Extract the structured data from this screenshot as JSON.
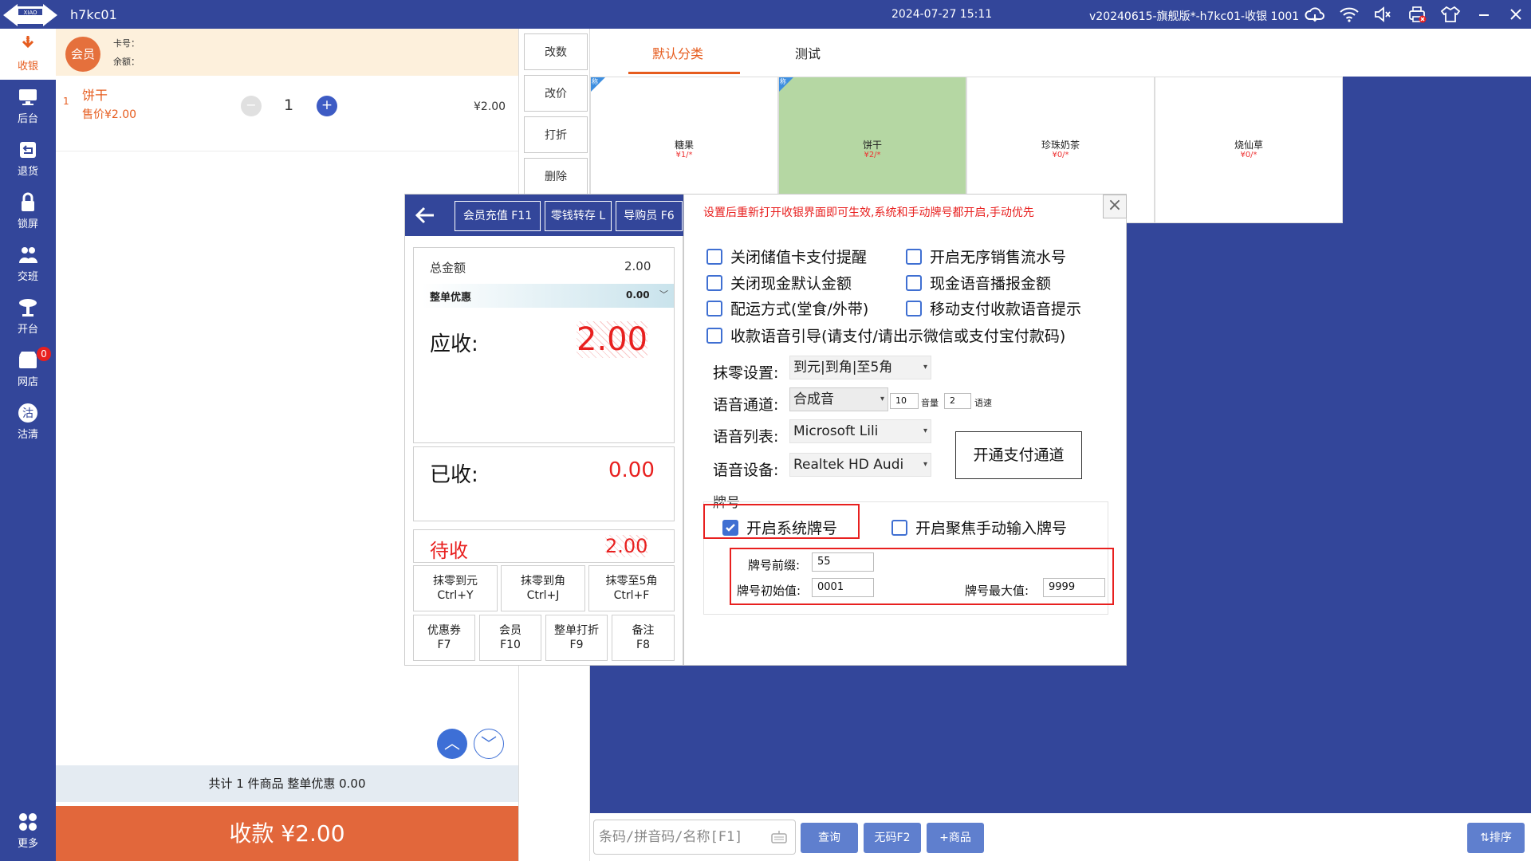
{
  "titlebar": {
    "logo_text": "XIAO",
    "shop": "h7kc01",
    "datetime": "2024-07-27 15:11",
    "version": "v20240615-旗舰版*-h7kc01-收银 1001",
    "icons": [
      "cloud-icon",
      "wifi-icon",
      "volume-mute-icon",
      "printer-icon",
      "shirt-icon",
      "minimize-icon",
      "close-icon"
    ]
  },
  "sidebar": {
    "items": [
      {
        "label": "收银",
        "icon": "cash-register-icon"
      },
      {
        "label": "后台",
        "icon": "monitor-icon"
      },
      {
        "label": "退货",
        "icon": "return-icon"
      },
      {
        "label": "锁屏",
        "icon": "lock-icon"
      },
      {
        "label": "交班",
        "icon": "shift-icon"
      },
      {
        "label": "开台",
        "icon": "table-icon"
      },
      {
        "label": "网店",
        "icon": "online-shop-icon"
      },
      {
        "label": "沽清",
        "icon": "soldout-icon"
      },
      {
        "label": "更多",
        "icon": "more-icon"
      }
    ],
    "badge": "0",
    "active_color": "#e65c1e"
  },
  "member": {
    "button": "会员",
    "card_label": "卡号：",
    "balance_label": "余额："
  },
  "order": {
    "items": [
      {
        "index": "1",
        "name": "饼干",
        "price": "售价¥2.00",
        "qty": "1",
        "minus": "−",
        "plus": "+",
        "subtotal": "¥2.00"
      }
    ],
    "summary": "共计 1 件商品 整单优惠 0.00",
    "pay_button": "收款    ¥2.00",
    "scroll_up": "︿",
    "scroll_down": "﹀"
  },
  "actions": [
    "改数",
    "改价",
    "打折",
    "删除"
  ],
  "category_tabs": [
    {
      "label": "默认分类",
      "active": true
    },
    {
      "label": "测试",
      "active": false
    }
  ],
  "products": [
    {
      "name": "糖果",
      "price": "¥1/*",
      "corner": "称",
      "highlight": false
    },
    {
      "name": "饼干",
      "price": "¥2/*",
      "corner": "称",
      "highlight": true
    },
    {
      "name": "珍珠奶茶",
      "price": "¥0/*",
      "corner": "",
      "highlight": false
    },
    {
      "name": "烧仙草",
      "price": "¥0/*",
      "corner": "",
      "highlight": false
    }
  ],
  "search": {
    "placeholder": "条码/拼音码/名称[F1]",
    "query": "查询",
    "no_code": "无码F2",
    "add_product": "+商品",
    "sort": "⇅排序"
  },
  "payment": {
    "header_buttons": [
      "会员充值 F11",
      "零钱转存 L",
      "导购员 F6"
    ],
    "total_label": "总金额",
    "total_value": "2.00",
    "discount_label": "整单优惠",
    "discount_value": "0.00",
    "receivable_label": "应收:",
    "receivable_value": "2.00",
    "received_label": "已收:",
    "received_value": "0.00",
    "pending_label": "待收",
    "pending_value": "2.00",
    "round_buttons": [
      {
        "line1": "抹零到元",
        "line2": "Ctrl+Y"
      },
      {
        "line1": "抹零到角",
        "line2": "Ctrl+J"
      },
      {
        "line1": "抹零至5角",
        "line2": "Ctrl+F"
      }
    ],
    "func_buttons": [
      {
        "line1": "优惠券",
        "line2": "F7"
      },
      {
        "line1": "会员",
        "line2": "F10"
      },
      {
        "line1": "整单打折",
        "line2": "F9"
      },
      {
        "line1": "备注",
        "line2": "F8"
      }
    ]
  },
  "settings": {
    "notice": "设置后重新打开收银界面即可生效,系统和手动牌号都开启,手动优先",
    "close": "×",
    "checkboxes": [
      {
        "label": "关闭储值卡支付提醒",
        "checked": false
      },
      {
        "label": "开启无序销售流水号",
        "checked": false
      },
      {
        "label": "关闭现金默认金额",
        "checked": false
      },
      {
        "label": "现金语音播报金额",
        "checked": false
      },
      {
        "label": "配运方式(堂食/外带)",
        "checked": false
      },
      {
        "label": "移动支付收款语音提示",
        "checked": false
      },
      {
        "label": "收款语音引导(请支付/请出示微信或支付宝付款码)",
        "checked": false
      }
    ],
    "rounding_label": "抹零设置:",
    "rounding_value": "到元|到角|至5角",
    "voice_channel_label": "语音通道:",
    "voice_channel_value": "合成音",
    "volume_value": "10",
    "volume_label": "音量",
    "speed_value": "2",
    "speed_label": "语速",
    "voice_list_label": "语音列表:",
    "voice_list_value": "Microsoft Lili",
    "voice_device_label": "语音设备:",
    "voice_device_value": "Realtek HD Audi",
    "open_channel_button": "开通支付通道",
    "plate_section": "牌号",
    "system_plate": {
      "label": "开启系统牌号",
      "checked": true
    },
    "manual_plate": {
      "label": "开启聚焦手动输入牌号",
      "checked": false
    },
    "prefix_label": "牌号前缀:",
    "prefix_value": "55",
    "initial_label": "牌号初始值:",
    "initial_value": "0001",
    "max_label": "牌号最大值:",
    "max_value": "9999"
  }
}
